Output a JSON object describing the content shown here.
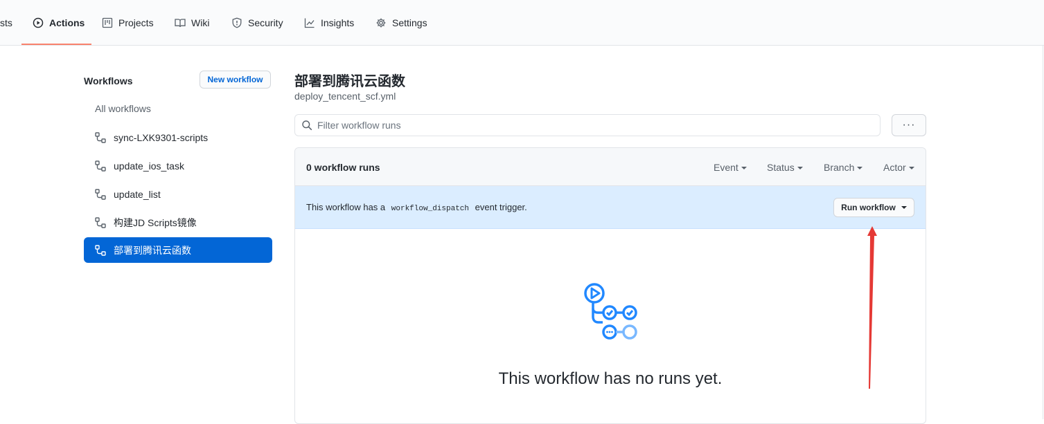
{
  "nav": {
    "tabs": [
      {
        "label": "sts",
        "icon": "pull-request-icon"
      },
      {
        "label": "Actions",
        "icon": "play-icon",
        "active": true
      },
      {
        "label": "Projects",
        "icon": "project-icon"
      },
      {
        "label": "Wiki",
        "icon": "book-icon"
      },
      {
        "label": "Security",
        "icon": "shield-icon"
      },
      {
        "label": "Insights",
        "icon": "graph-icon"
      },
      {
        "label": "Settings",
        "icon": "gear-icon"
      }
    ],
    "accent_color": "#f9826c"
  },
  "sidebar": {
    "title": "Workflows",
    "new_workflow_label": "New workflow",
    "all_workflows_label": "All workflows",
    "items": [
      {
        "label": "sync-LXK9301-scripts"
      },
      {
        "label": "update_ios_task"
      },
      {
        "label": "update_list"
      },
      {
        "label": "构建JD Scripts镜像"
      },
      {
        "label": "部署到腾讯云函数",
        "selected": true
      }
    ],
    "selected_color": "#0366d6"
  },
  "main": {
    "title": "部署到腾讯云函数",
    "filename": "deploy_tencent_scf.yml",
    "filter_placeholder": "Filter workflow runs",
    "more_label": "···",
    "runs_count": "0 workflow runs",
    "filters": [
      "Event",
      "Status",
      "Branch",
      "Actor"
    ],
    "dispatch": {
      "text_before": "This workflow has a",
      "code": "workflow_dispatch",
      "text_after": "event trigger.",
      "button_label": "Run workflow"
    },
    "empty_message": "This workflow has no runs yet."
  },
  "annotation": {
    "color": "#e53935"
  }
}
